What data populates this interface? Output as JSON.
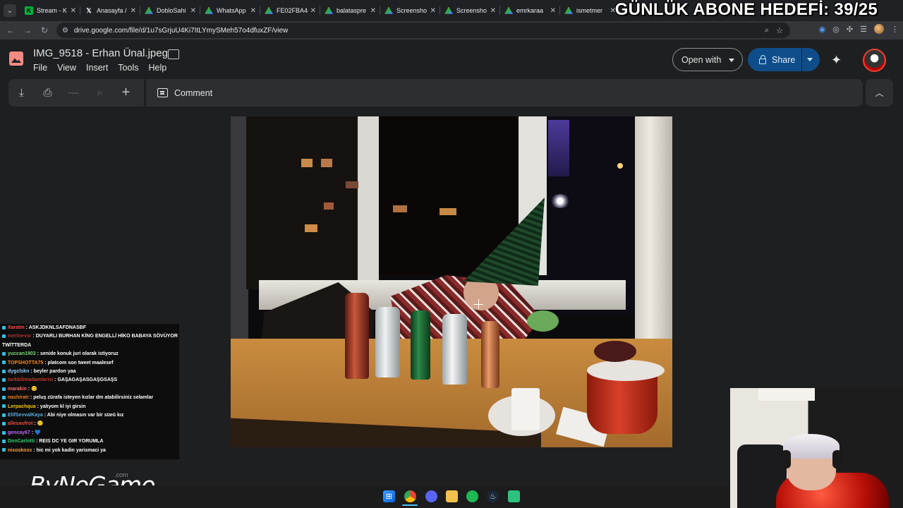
{
  "browser": {
    "tabs": [
      {
        "title": "Stream - K",
        "icon": "stream-favicon"
      },
      {
        "title": "Anasayfa /",
        "icon": "x-favicon"
      },
      {
        "title": "DobloSahi",
        "icon": "drive-favicon"
      },
      {
        "title": "WhatsApp",
        "icon": "drive-favicon"
      },
      {
        "title": "FE02FBA4-",
        "icon": "drive-favicon"
      },
      {
        "title": "balataspre",
        "icon": "drive-favicon"
      },
      {
        "title": "Screensho",
        "icon": "drive-favicon"
      },
      {
        "title": "Screensho",
        "icon": "drive-favicon"
      },
      {
        "title": "emrkaraa",
        "icon": "drive-favicon"
      },
      {
        "title": "ismetmer",
        "icon": "drive-favicon"
      }
    ],
    "url": "drive.google.com/file/d/1u7sGrjuU4Ki7ItLYmySMeh57o4dfuxZF/view"
  },
  "stream_overlay": {
    "goal_text": "GÜNLÜK ABONE HEDEFİ: 39/25",
    "logo": "ByNoGame",
    "logo_suffix": ".com"
  },
  "viewer": {
    "file_name": "IMG_9518 - Erhan Ünal.jpeg",
    "menu": [
      "File",
      "View",
      "Insert",
      "Tools",
      "Help"
    ],
    "open_with_label": "Open with",
    "share_label": "Share",
    "comment_label": "Comment"
  },
  "chat": [
    {
      "user": "Xaratm",
      "color": "#ff4a4a",
      "text": "ASKJDKNLSAFDNASBF"
    },
    {
      "user": "merlnevsr",
      "color": "#b03030",
      "text": "DUYARLI BURHAN KİNG ENGELLİ HİKO BABAYA SÖVÜYOR"
    },
    {
      "user": "",
      "color": "#ffffff",
      "text": "TWİTTERDA"
    },
    {
      "user": "yuccan1903",
      "color": "#7cd67c",
      "text": "senide konuk juri olarak istiyoruz"
    },
    {
      "user": "TOPSHOTTA75",
      "color": "#ff8c1a",
      "text": "platcom son tweet maalesef"
    },
    {
      "user": "dygclskn",
      "color": "#9bd0ff",
      "text": "beyler pardon yaa"
    },
    {
      "user": "turkbilimadamlarisi",
      "color": "#c0392b",
      "text": "GAŞAGAŞASGAŞGSAŞS"
    },
    {
      "user": "marakin",
      "color": "#ff6b6b",
      "text": "😊"
    },
    {
      "user": "nashiratr",
      "color": "#e67e22",
      "text": "peluş zürafa isteyen kızlar dm atabilirsiniz selamlar"
    },
    {
      "user": "Lerpachqua",
      "color": "#f1c40f",
      "text": "yalıyom kl iyi girsin"
    },
    {
      "user": "ElifSevvalKaya",
      "color": "#5dade2",
      "text": "Abi niye olmasın var bir süeü kız"
    },
    {
      "user": "allesaufrot",
      "color": "#e74c3c",
      "text": "🙂"
    },
    {
      "user": "gencay67",
      "color": "#bb66ff",
      "text": "💙"
    },
    {
      "user": "DonCarlotti",
      "color": "#2ecc71",
      "text": "REIS DC YE GIR YORUMLA"
    },
    {
      "user": "nisoskoss",
      "color": "#ff9f43",
      "text": "hic mi yok kadin yarismaci ya"
    }
  ],
  "taskbar": [
    "windows-start",
    "chrome",
    "discord",
    "file-explorer",
    "spotify",
    "steam",
    "app-green"
  ],
  "colors": {
    "page_bg": "#1e1f20",
    "toolbar_bg": "#2d2e30",
    "share_bg": "#0f4d8a",
    "tabstrip_bg": "#202124"
  }
}
